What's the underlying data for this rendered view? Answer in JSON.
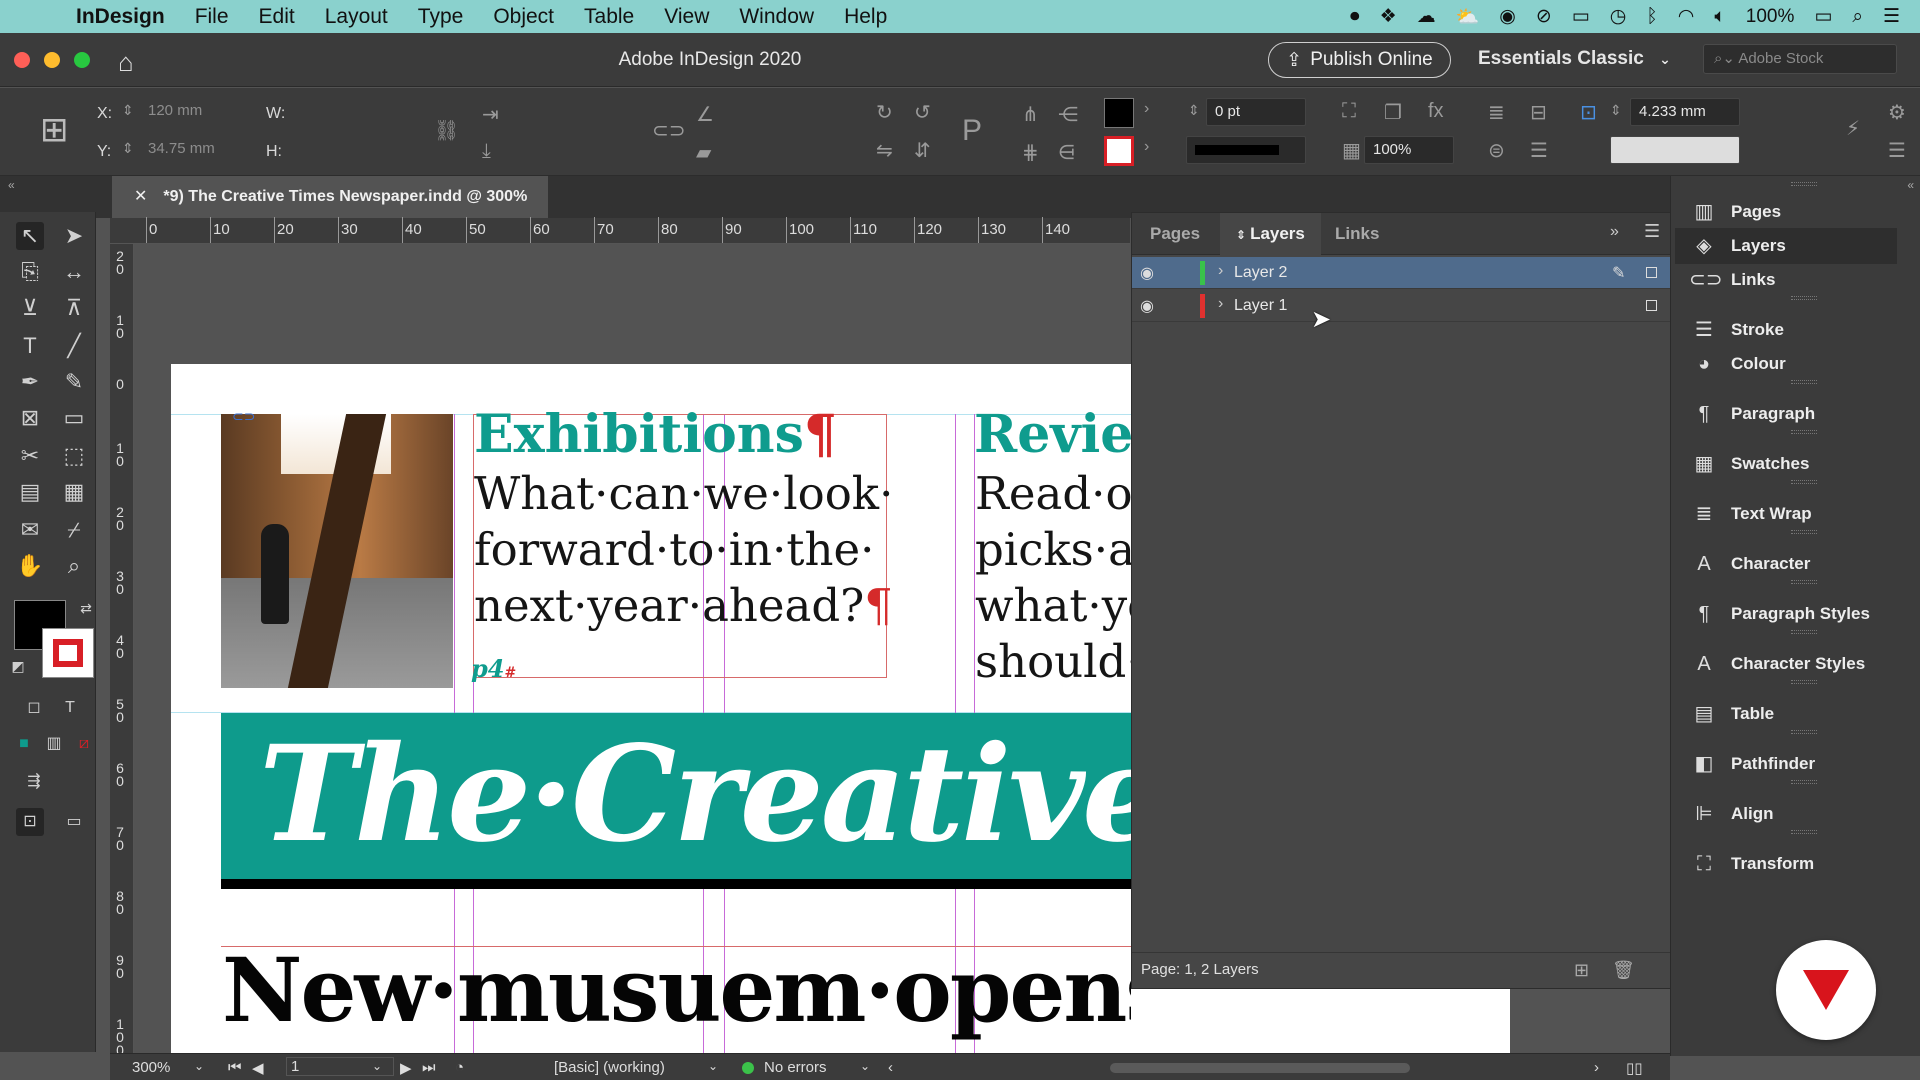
{
  "menubar": {
    "app_name": "InDesign",
    "items": [
      "File",
      "Edit",
      "Layout",
      "Type",
      "Object",
      "Table",
      "View",
      "Window",
      "Help"
    ],
    "battery": "100%"
  },
  "window": {
    "title": "Adobe InDesign 2020",
    "publish_label": "Publish Online",
    "workspace": "Essentials Classic",
    "stock_placeholder": "Adobe Stock"
  },
  "control": {
    "x_label": "X:",
    "x_value": "120 mm",
    "y_label": "Y:",
    "y_value": "34.75 mm",
    "w_label": "W:",
    "h_label": "H:",
    "stroke_weight": "0 pt",
    "scale": "100%",
    "gutter": "4.233 mm"
  },
  "document_tab": {
    "title": "*9) The Creative Times Newspaper.indd @ 300%"
  },
  "ruler": {
    "h_ticks": [
      "0",
      "10",
      "20",
      "30",
      "40",
      "50",
      "60",
      "70",
      "80",
      "90",
      "100",
      "110",
      "120",
      "130",
      "140"
    ],
    "v_ticks": [
      "2\n0",
      "1\n0",
      "0",
      "1\n0",
      "2\n0",
      "3\n0",
      "4\n0",
      "5\n0",
      "6\n0",
      "7\n0",
      "8\n0",
      "9\n0",
      "1\n0\n0"
    ]
  },
  "document": {
    "col1_heading": "Exhibitions",
    "col1_body": [
      "What·can·we·look·",
      "forward·to·in·the·",
      "next·year·ahead?"
    ],
    "col1_page_ref": "p4",
    "col2_heading": "Review",
    "col2_body": [
      "Read·ou",
      "picks·ar",
      "what·yo",
      "should·"
    ],
    "banner_text": "The·Creative·T",
    "headline": "New·musuem·opens·with·"
  },
  "layers_panel": {
    "tabs": [
      "Pages",
      "Layers",
      "Links"
    ],
    "active_tab": "Layers",
    "layers": [
      {
        "name": "Layer 2",
        "color": "#39c24a",
        "selected": true
      },
      {
        "name": "Layer 1",
        "color": "#e0312f",
        "selected": false
      }
    ],
    "footer": "Page: 1, 2 Layers"
  },
  "dock": {
    "items": [
      {
        "label": "Pages",
        "icon": "pages-icon"
      },
      {
        "label": "Layers",
        "icon": "layers-icon"
      },
      {
        "label": "Links",
        "icon": "links-icon"
      },
      {
        "label": "Stroke",
        "icon": "stroke-icon"
      },
      {
        "label": "Colour",
        "icon": "colour-icon"
      },
      {
        "label": "Paragraph",
        "icon": "paragraph-icon"
      },
      {
        "label": "Swatches",
        "icon": "swatches-icon"
      },
      {
        "label": "Text Wrap",
        "icon": "text-wrap-icon"
      },
      {
        "label": "Character",
        "icon": "character-icon"
      },
      {
        "label": "Paragraph Styles",
        "icon": "paragraph-styles-icon"
      },
      {
        "label": "Character Styles",
        "icon": "character-styles-icon"
      },
      {
        "label": "Table",
        "icon": "table-icon"
      },
      {
        "label": "Pathfinder",
        "icon": "pathfinder-icon"
      },
      {
        "label": "Align",
        "icon": "align-icon"
      },
      {
        "label": "Transform",
        "icon": "transform-icon"
      }
    ]
  },
  "status": {
    "zoom": "300%",
    "page": "1",
    "style": "[Basic] (working)",
    "preflight": "No errors"
  },
  "colors": {
    "accent_teal": "#0e9b8c",
    "menubar": "#8ad1cd",
    "layer_selected": "#4f6b8c"
  }
}
